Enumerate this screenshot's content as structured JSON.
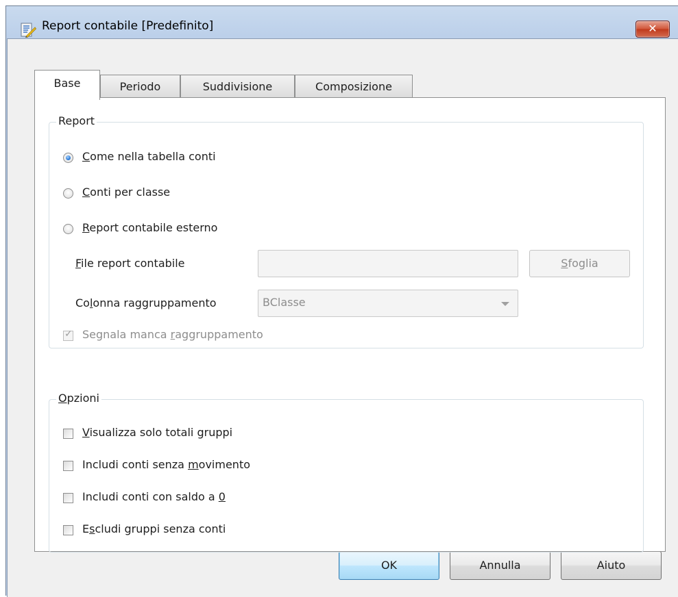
{
  "window": {
    "title": "Report contabile [Predefinito]",
    "close_glyph": "✕",
    "app_icon": "report-document-icon"
  },
  "tabs": [
    {
      "label": "Base",
      "active": true
    },
    {
      "label": "Periodo",
      "active": false
    },
    {
      "label": "Suddivisione",
      "active": false
    },
    {
      "label": "Composizione",
      "active": false
    }
  ],
  "report_group": {
    "legend": "Report",
    "radios": [
      {
        "pre": "",
        "key": "C",
        "post": "ome nella tabella conti",
        "checked": true
      },
      {
        "pre": "",
        "key": "C",
        "post": "onti per classe",
        "checked": false
      },
      {
        "pre": "",
        "key": "R",
        "post": "eport contabile esterno",
        "checked": false
      }
    ],
    "file_label": {
      "pre": "",
      "key": "F",
      "post": "ile report contabile"
    },
    "file_value": "",
    "browse_button": {
      "pre": "",
      "key": "S",
      "post": "foglia"
    },
    "group_col_label": {
      "pre": "Co",
      "key": "l",
      "post": "onna raggruppamento"
    },
    "group_col_value": "BClasse",
    "missing_group_check": {
      "pre": "Segnala manca ",
      "key": "r",
      "post": "aggruppamento",
      "checked": true,
      "disabled": true
    }
  },
  "options_group": {
    "legend": {
      "pre": "",
      "key": "O",
      "post": "pzioni"
    },
    "checkboxes": [
      {
        "pre": "",
        "key": "V",
        "post": "isualizza solo totali gruppi",
        "checked": false
      },
      {
        "pre": "Includi conti senza ",
        "key": "m",
        "post": "ovimento",
        "checked": false
      },
      {
        "pre": "Includi conti con saldo a ",
        "key": "0",
        "post": "",
        "checked": false
      },
      {
        "pre": "E",
        "key": "s",
        "post": "cludi  gruppi senza conti",
        "checked": false
      }
    ]
  },
  "buttons": {
    "ok": "OK",
    "cancel": "Annulla",
    "help": "Aiuto"
  },
  "colors": {
    "title_gradient": "#c3d6ee",
    "close_red": "#c8452b",
    "radio_selected": "#1e6fd0",
    "disabled_text": "#8d8d8d",
    "default_button_border": "#3c7fb1"
  }
}
